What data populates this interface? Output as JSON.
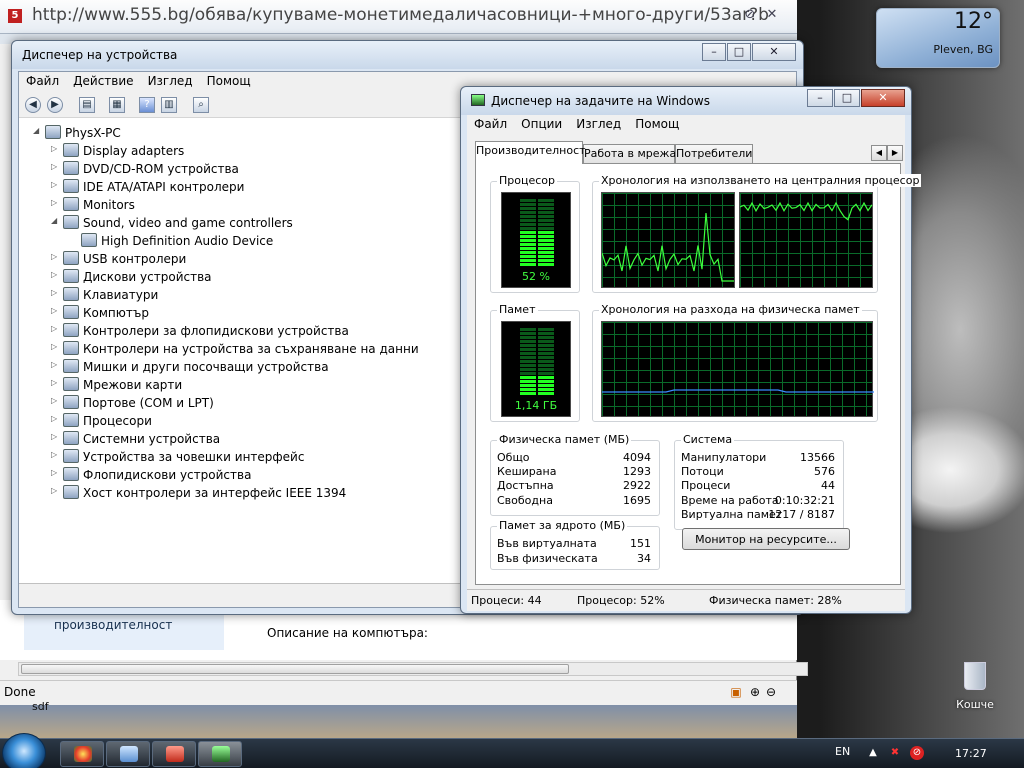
{
  "browser": {
    "url": "http://www.555.bg/обява/купуваме-монетимедаличасовници-+много-други/53ar?b",
    "content_left": "производителност",
    "content_desc": "Описание на компютъра:",
    "status": "Done",
    "below_status": "sdf"
  },
  "devmgr": {
    "title": "Диспечер на устройства",
    "menu": [
      "Файл",
      "Действие",
      "Изглед",
      "Помощ"
    ],
    "root": "PhysX-PC",
    "items": [
      {
        "label": "Display adapters",
        "expanded": false
      },
      {
        "label": "DVD/CD-ROM устройства",
        "expanded": false
      },
      {
        "label": "IDE ATA/ATAPI контролери",
        "expanded": false
      },
      {
        "label": "Monitors",
        "expanded": false
      },
      {
        "label": "Sound, video and game controllers",
        "expanded": true
      },
      {
        "label": "High Definition Audio Device",
        "child": true
      },
      {
        "label": "USB контролери",
        "expanded": false
      },
      {
        "label": "Дискови устройства",
        "expanded": false
      },
      {
        "label": "Клавиатури",
        "expanded": false
      },
      {
        "label": "Компютър",
        "expanded": false
      },
      {
        "label": "Контролери за флопидискови устройства",
        "expanded": false
      },
      {
        "label": "Контролери на устройства за съхраняване на данни",
        "expanded": false
      },
      {
        "label": "Мишки и други посочващи устройства",
        "expanded": false
      },
      {
        "label": "Мрежови карти",
        "expanded": false
      },
      {
        "label": "Портове (COM и LPT)",
        "expanded": false
      },
      {
        "label": "Процесори",
        "expanded": false
      },
      {
        "label": "Системни устройства",
        "expanded": false
      },
      {
        "label": "Устройства за човешки интерфейс",
        "expanded": false
      },
      {
        "label": "Флопидискови устройства",
        "expanded": false
      },
      {
        "label": "Хост контролери за интерфейс IEEE 1394",
        "expanded": false
      }
    ]
  },
  "taskmgr": {
    "title": "Диспечер на задачите на Windows",
    "menu": [
      "Файл",
      "Опции",
      "Изглед",
      "Помощ"
    ],
    "tabs": [
      "Производителност",
      "Работа в мрежа",
      "Потребители"
    ],
    "active_tab": 0,
    "cpu_label": "Процесор",
    "cpu_value": "52 %",
    "cpu_percent": 52,
    "cpu_history_label": "Хронология на използването на централния процесор",
    "mem_label": "Памет",
    "mem_value": "1,14 ГБ",
    "mem_percent": 28,
    "mem_history_label": "Хронология на разхода на физическа памет",
    "phys_mem": {
      "title": "Физическа памет (МБ)",
      "rows": [
        {
          "k": "Общо",
          "v": "4094"
        },
        {
          "k": "Кеширана",
          "v": "1293"
        },
        {
          "k": "Достъпна",
          "v": "2922"
        },
        {
          "k": "Свободна",
          "v": "1695"
        }
      ]
    },
    "kernel_mem": {
      "title": "Памет за ядрото (МБ)",
      "rows": [
        {
          "k": "Във виртуалната",
          "v": "151"
        },
        {
          "k": "Във физическата",
          "v": "34"
        }
      ]
    },
    "system": {
      "title": "Система",
      "rows": [
        {
          "k": "Манипулатори",
          "v": "13566"
        },
        {
          "k": "Потоци",
          "v": "576"
        },
        {
          "k": "Процеси",
          "v": "44"
        },
        {
          "k": "Време на работа",
          "v": "0:10:32:21"
        },
        {
          "k": "Виртуална памет",
          "v": "1217 / 8187"
        }
      ]
    },
    "resource_monitor_button": "Монитор на ресурсите...",
    "status": {
      "processes": "Процеси: 44",
      "cpu": "Процесор: 52%",
      "memory": "Физическа памет: 28%"
    }
  },
  "weather": {
    "temp": "12°",
    "city": "Pleven, BG"
  },
  "desktop": {
    "recycle_bin": "Кошче"
  },
  "taskbar": {
    "lang": "EN",
    "clock": "17:27"
  }
}
